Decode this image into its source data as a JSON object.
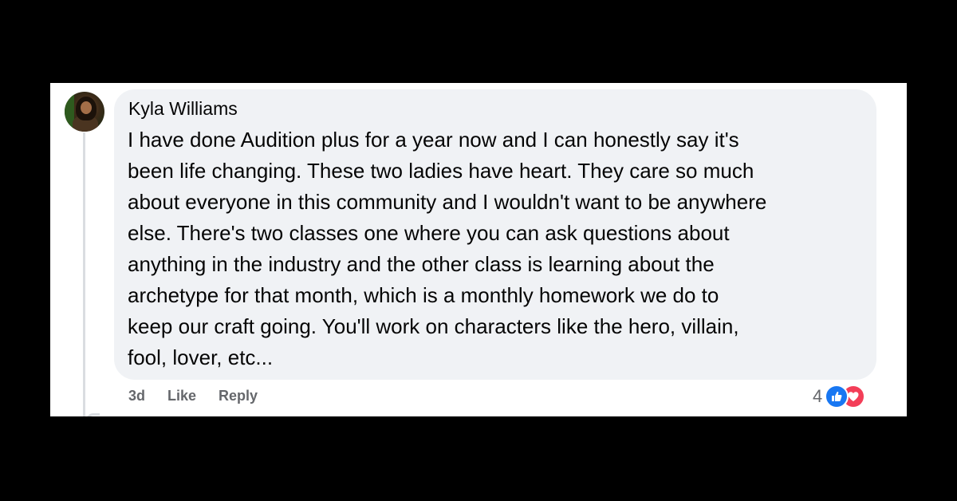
{
  "comment": {
    "author": "Kyla Williams",
    "lines": [
      "I have done Audition plus for a year now and I can honestly say it's",
      "been life changing. These two ladies have heart. They care so much",
      "about everyone in this community and I wouldn't want to be anywhere",
      "else. There's two classes one where you can ask questions about",
      "anything in the industry and the other class is learning about the",
      "archetype for that month, which is a monthly homework we do to",
      "keep our craft going. You'll work on characters like the hero, villain,",
      "fool, lover, etc..."
    ],
    "time": "3d",
    "like_label": "Like",
    "reply_label": "Reply",
    "reaction_count": "4",
    "reactions": [
      "like-icon",
      "love-icon"
    ]
  },
  "colors": {
    "bubble": "#f0f2f5",
    "meta_text": "#65676b",
    "like_blue": "#1877f2",
    "love_red": "#f33e58"
  }
}
